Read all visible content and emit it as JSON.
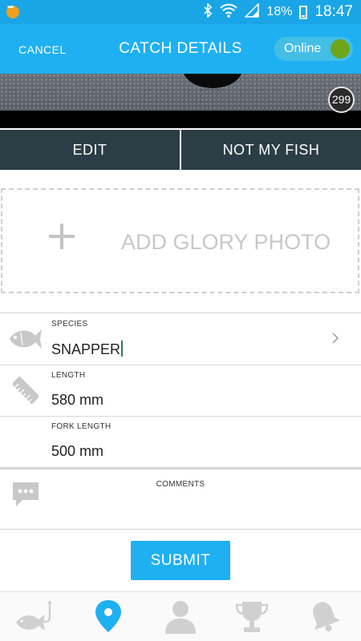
{
  "status_bar": {
    "battery": "18%",
    "time": "18:47"
  },
  "app_bar": {
    "cancel_label": "CANCEL",
    "title": "CATCH DETAILS",
    "online_label": "Online"
  },
  "photo": {
    "badge_count": "299"
  },
  "actions": {
    "edit_label": "EDIT",
    "not_my_fish_label": "NOT MY FISH"
  },
  "glory": {
    "label": "ADD GLORY PHOTO"
  },
  "form": {
    "species": {
      "label": "SPECIES",
      "value": "SNAPPER",
      "icon": "fish-icon"
    },
    "length": {
      "label": "LENGTH",
      "value": "580 mm",
      "icon": "ruler-icon"
    },
    "fork_length": {
      "label": "FORK LENGTH",
      "value": "500 mm"
    },
    "comments": {
      "label": "COMMENTS",
      "icon": "speech-bubble-icon"
    }
  },
  "submit_label": "SUBMIT",
  "tabs": [
    {
      "icon": "fish-hook-icon",
      "active": false
    },
    {
      "icon": "map-pin-icon",
      "active": true
    },
    {
      "icon": "person-icon",
      "active": false
    },
    {
      "icon": "trophy-icon",
      "active": false
    },
    {
      "icon": "bell-icon",
      "active": false
    }
  ],
  "colors": {
    "primary": "#1fb0f2",
    "dark": "#2b3d45",
    "toggle_on": "#6ea51a",
    "inactive_icon": "#d0d0d0"
  }
}
